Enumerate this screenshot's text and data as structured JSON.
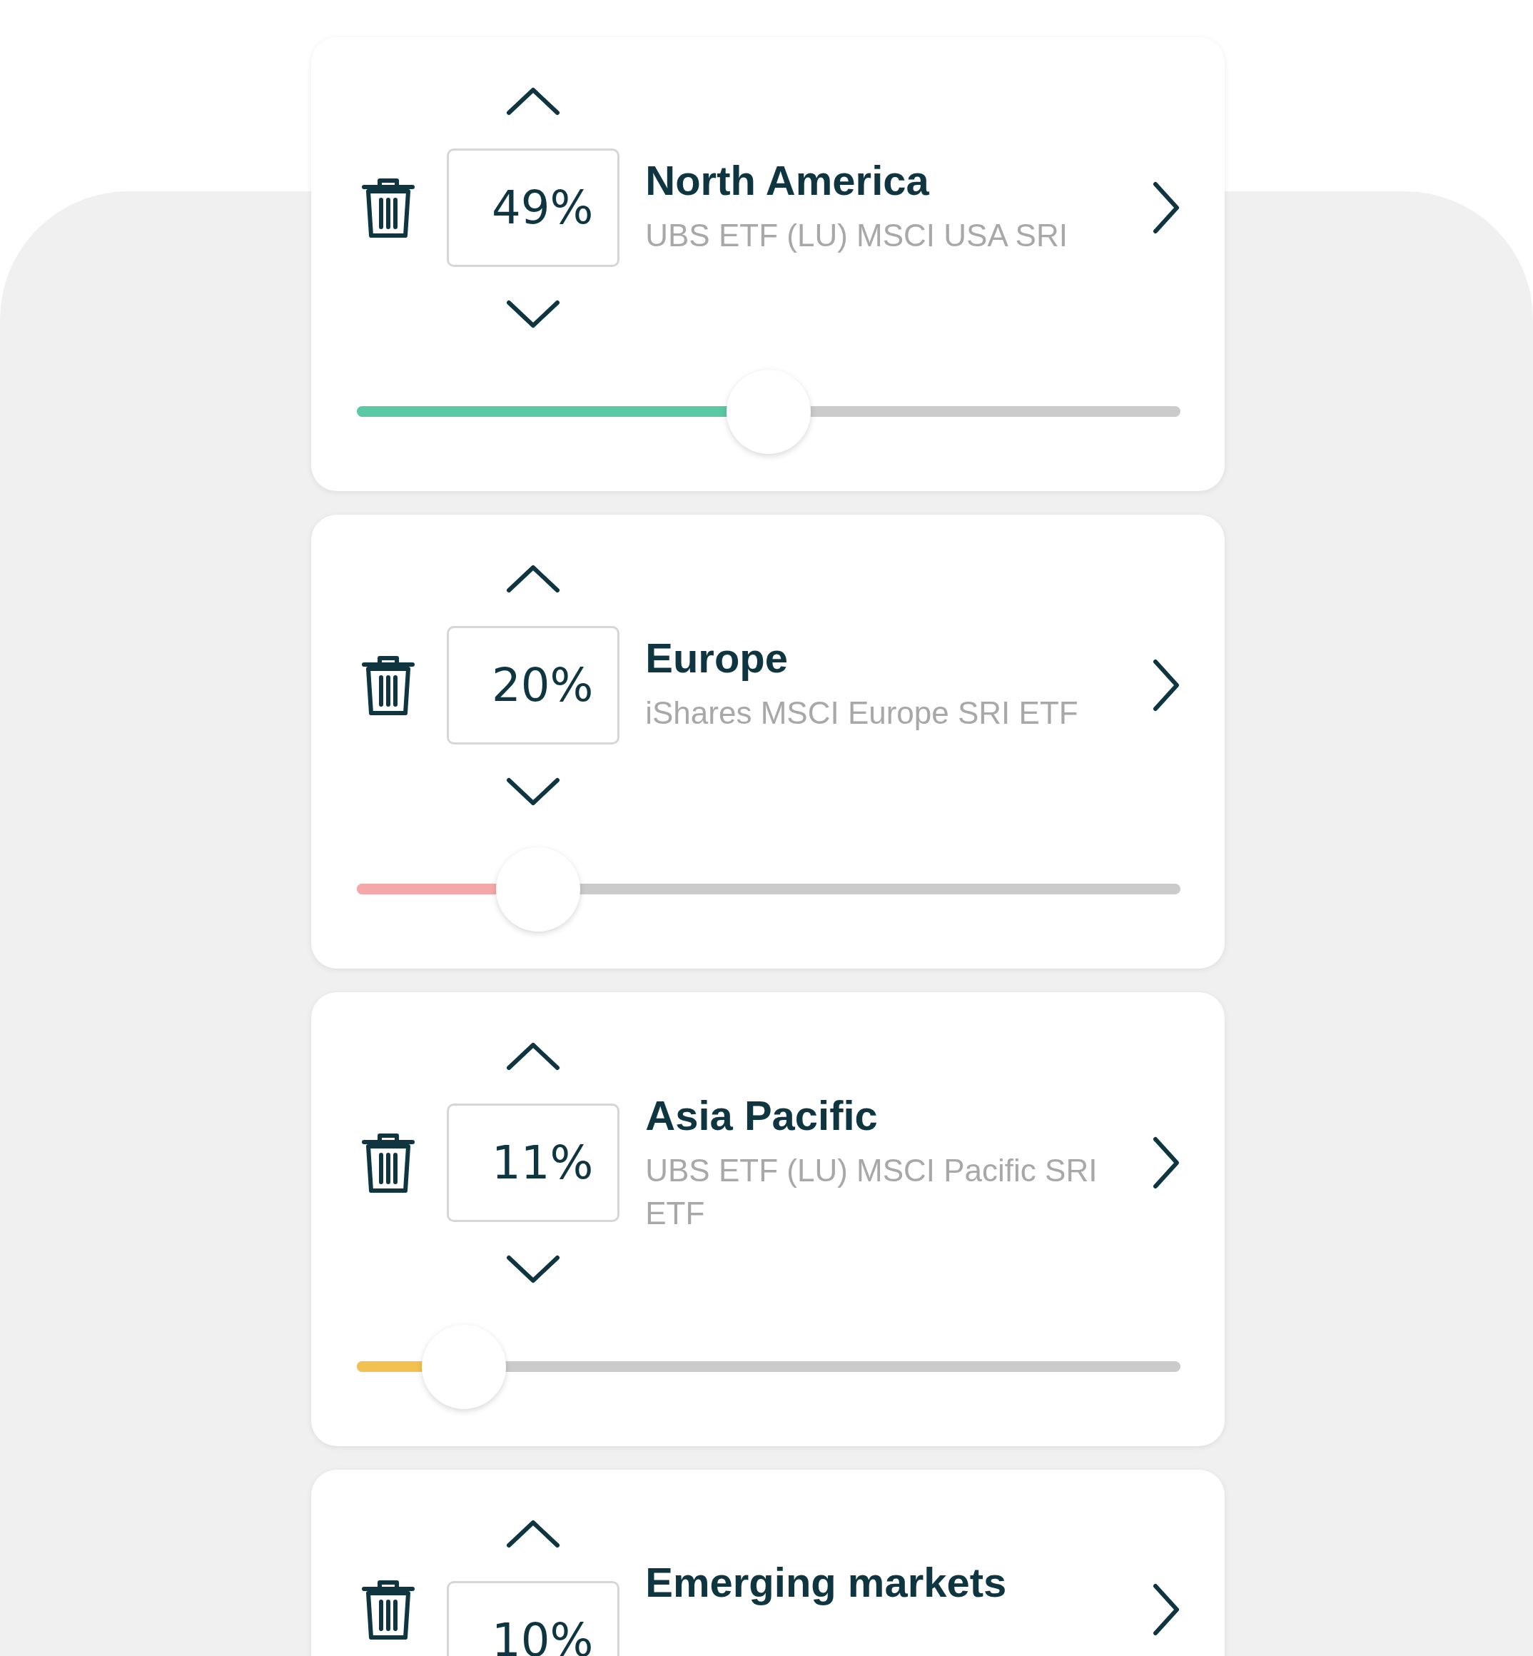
{
  "allocations": [
    {
      "percent": "49%",
      "name": "North America",
      "fund": "UBS ETF (LU) MSCI USA SRI",
      "level": 0.5,
      "color": "#5bc8a6"
    },
    {
      "percent": "20%",
      "name": "Europe",
      "fund": "iShares MSCI Europe SRI ETF",
      "level": 0.22,
      "color": "#f5a8a8"
    },
    {
      "percent": "11%",
      "name": "Asia Pacific",
      "fund": "UBS ETF (LU) MSCI Pacific SRI ETF",
      "level": 0.13,
      "color": "#f3c14f"
    },
    {
      "percent": "10%",
      "name": "Emerging markets"
    }
  ]
}
